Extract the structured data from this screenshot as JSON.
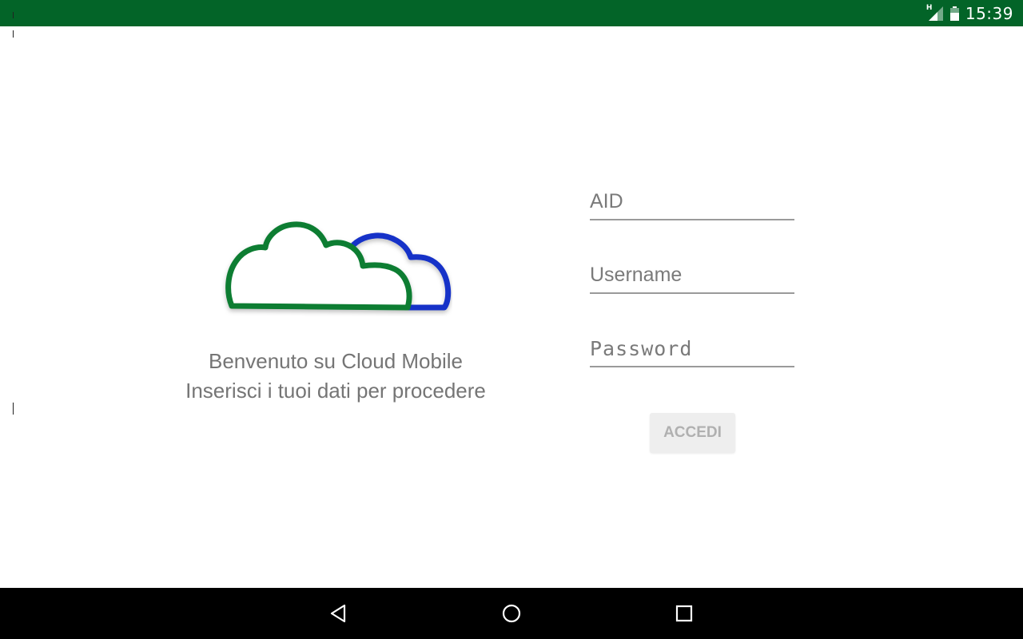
{
  "status_bar": {
    "time": "15:39",
    "network_type": "H",
    "icons": [
      "signal-icon",
      "battery-icon"
    ],
    "background_color": "#036428"
  },
  "welcome": {
    "line1": "Benvenuto su Cloud Mobile",
    "line2": "Inserisci i tuoi dati per procedere"
  },
  "logo": {
    "icon": "cloud-logo-icon",
    "colors": {
      "front_cloud": "#0a7d32",
      "back_cloud": "#1430c8"
    }
  },
  "form": {
    "aid_placeholder": "AID",
    "username_placeholder": "Username",
    "password_placeholder": "Password",
    "submit_label": "ACCEDI"
  },
  "nav_bar": {
    "buttons": [
      "back-icon",
      "home-icon",
      "recents-icon"
    ]
  }
}
